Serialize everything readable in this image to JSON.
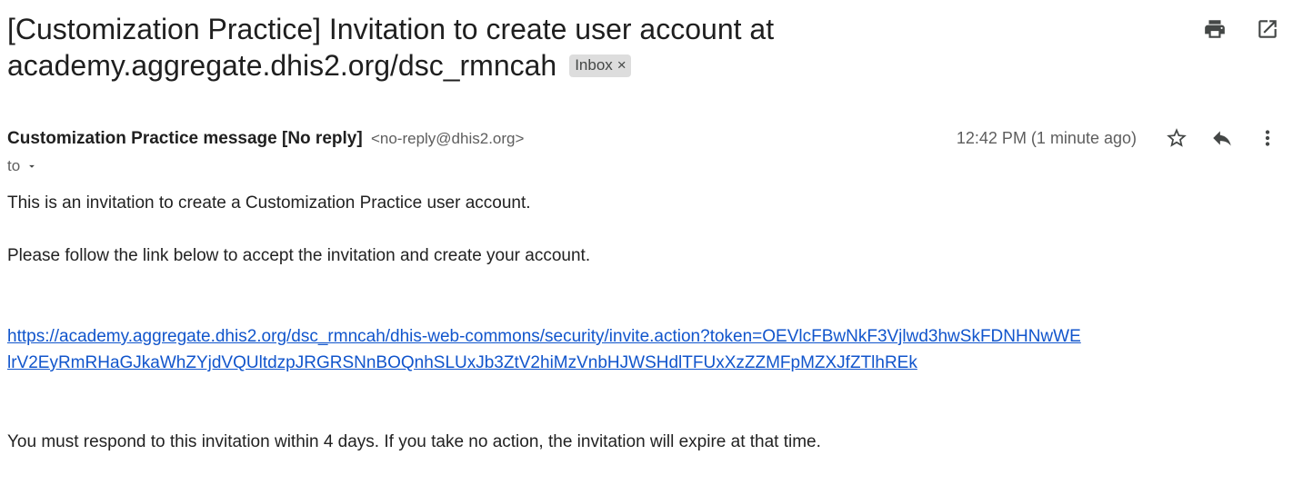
{
  "email": {
    "subject_line1": "[Customization Practice] Invitation to create user account at",
    "subject_line2": "academy.aggregate.dhis2.org/dsc_rmncah",
    "label_chip": "Inbox",
    "label_remove": "×",
    "sender_name": "Customization Practice message [No reply]",
    "sender_email": "<no-reply@dhis2.org>",
    "recipient_label": "to",
    "timestamp": "12:42 PM (1 minute ago)",
    "body": {
      "line1": "This is an invitation to create a Customization Practice user account.",
      "line2": "Please follow the link below to accept the invitation and create your account.",
      "link_line1": "https://academy.aggregate.dhis2.org/dsc_rmncah/dhis-web-commons/security/invite.action?token=OEVlcFBwNkF3Vjlwd3hwSkFDNHNwWE",
      "link_line2": "lrV2EyRmRHaGJkaWhZYjdVQUltdzpJRGRSNnBOQnhSLUxJb3ZtV2hiMzVnbHJWSHdlTFUxXzZZMFpMZXJfZTlhREk",
      "line3": "You must respond to this invitation within 4 days. If you take no action, the invitation will expire at that time."
    }
  },
  "icons": {
    "print": "print-icon",
    "open_new_window": "open-in-new-window-icon",
    "star": "star-icon",
    "reply": "reply-icon",
    "more": "more-vertical-icon",
    "recipient_dropdown": "caret-down-icon"
  },
  "colors": {
    "link": "#1155cc",
    "chip_bg": "#dddddd",
    "text": "#1f1f1f",
    "muted": "#5e5e5e"
  }
}
